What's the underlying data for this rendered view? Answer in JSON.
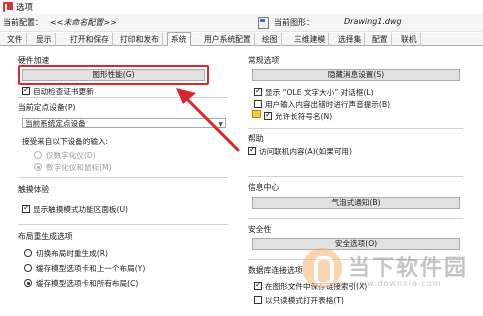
{
  "window": {
    "title": "选项"
  },
  "profile": {
    "label": "当前配置：",
    "value": "<<未命名配置>>",
    "drawing_label": "当前图形：",
    "drawing_value": "Drawing1.dwg"
  },
  "tabs": [
    {
      "label": "文件"
    },
    {
      "label": "显示"
    },
    {
      "label": "打开和保存"
    },
    {
      "label": "打印和发布"
    },
    {
      "label": "系统"
    },
    {
      "label": "用户系统配置"
    },
    {
      "label": "绘图"
    },
    {
      "label": "三维建模"
    },
    {
      "label": "选择集"
    },
    {
      "label": "配置"
    },
    {
      "label": "联机"
    }
  ],
  "active_tab": "系统",
  "hardware": {
    "title": "硬件加速",
    "graphics_button": "图形性能(G)",
    "auto_check": "自动检查证书更新"
  },
  "pointing": {
    "title": "当前定点设备(P)",
    "device_value": "当前系统定点设备",
    "accept_label": "接受来自以下设备的输入:",
    "option_digitizer": "仅数字化仪(D)",
    "option_digitizer_mouse": "数字化仪和鼠标(M)"
  },
  "touch": {
    "title": "触摸体验",
    "show_ribbon": "显示触摸模式功能区面板(U)"
  },
  "layout_regen": {
    "title": "布局重生成选项",
    "opt1": "切换布局时重生成(R)",
    "opt2": "缓存模型选项卡和上一个布局(Y)",
    "opt3": "缓存模型选项卡和所有布局(C)"
  },
  "general": {
    "title": "常规选项",
    "hidden_messages_button": "隐藏消息设置(S)",
    "ole_dialog": "显示 “OLE 文字大小” 对话框(L)",
    "beep_on_error": "用户输入内容出错时进行声音提示(B)",
    "long_symbol_names": "允许长符号名(N)"
  },
  "help": {
    "title": "帮助",
    "online_content": "访问联机内容(A)(如果可用)"
  },
  "info_center": {
    "title": "信息中心",
    "balloon_button": "气泡式通知(B)"
  },
  "security": {
    "title": "安全性",
    "security_button": "安全选项(O)"
  },
  "db_connection": {
    "title": "数据库连接选项",
    "store_links": "在图形文件中保存链接索引(X)",
    "readonly_tables": "以只读模式打开表格(T)"
  },
  "watermark": {
    "text": "当下软件园",
    "url": "www.downxia.com"
  },
  "colors": {
    "highlight": "#e0262b",
    "arrow": "#d9262e"
  }
}
